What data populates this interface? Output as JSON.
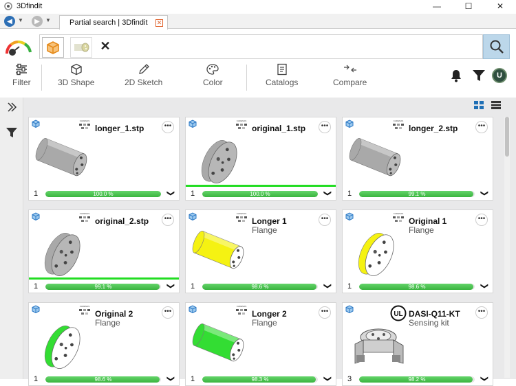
{
  "window": {
    "title": "3Dfindit",
    "controls": [
      "minimize",
      "maximize",
      "close"
    ]
  },
  "tab": {
    "label": "Partial search | 3Dfindit"
  },
  "toolbar": {
    "filter_label": "Filter",
    "shape_label": "3D Shape",
    "sketch_label": "2D Sketch",
    "color_label": "Color",
    "catalogs_label": "Catalogs",
    "compare_label": "Compare"
  },
  "user": {
    "avatar_letter": "U"
  },
  "colors": {
    "accent": "#bcd7ea",
    "progress": "#3ab43f",
    "selected": "#22dd22",
    "cad_yellow": "#f5f212",
    "cad_green": "#33dd33",
    "cad_gray": "#a9a9a9"
  },
  "cards": [
    {
      "title": "longer_1.stp",
      "subtitle": "",
      "count": "1",
      "match": "100.0 %",
      "progress": 1.0,
      "selected": false,
      "logo": "CADENAS",
      "thumb": "gray-cylinder"
    },
    {
      "title": "original_1.stp",
      "subtitle": "",
      "count": "1",
      "match": "100.0 %",
      "progress": 1.0,
      "selected": true,
      "logo": "CADENAS",
      "thumb": "gray-disc"
    },
    {
      "title": "longer_2.stp",
      "subtitle": "",
      "count": "1",
      "match": "99.1 %",
      "progress": 0.991,
      "selected": false,
      "logo": "CADENAS",
      "thumb": "gray-cylinder"
    },
    {
      "title": "original_2.stp",
      "subtitle": "",
      "count": "1",
      "match": "99.1 %",
      "progress": 0.991,
      "selected": true,
      "logo": "CADENAS",
      "thumb": "gray-disc"
    },
    {
      "title": "Longer 1",
      "subtitle": "Flange",
      "count": "1",
      "match": "98.6 %",
      "progress": 0.986,
      "selected": false,
      "logo": "CADENAS",
      "thumb": "yellow-cylinder"
    },
    {
      "title": "Original 1",
      "subtitle": "Flange",
      "count": "1",
      "match": "98.6 %",
      "progress": 0.986,
      "selected": false,
      "logo": "CADENAS",
      "thumb": "yellow-disc"
    },
    {
      "title": "Original 2",
      "subtitle": "Flange",
      "count": "1",
      "match": "98.6 %",
      "progress": 0.986,
      "selected": false,
      "logo": "CADENAS",
      "thumb": "green-disc"
    },
    {
      "title": "Longer 2",
      "subtitle": "Flange",
      "count": "1",
      "match": "98.3 %",
      "progress": 0.983,
      "selected": false,
      "logo": "CADENAS",
      "thumb": "green-cylinder"
    },
    {
      "title": "DASI-Q11-KT",
      "subtitle": "Sensing kit",
      "count": "3",
      "match": "98.2 %",
      "progress": 0.982,
      "selected": false,
      "logo": "UL",
      "thumb": "sensing-kit"
    }
  ]
}
